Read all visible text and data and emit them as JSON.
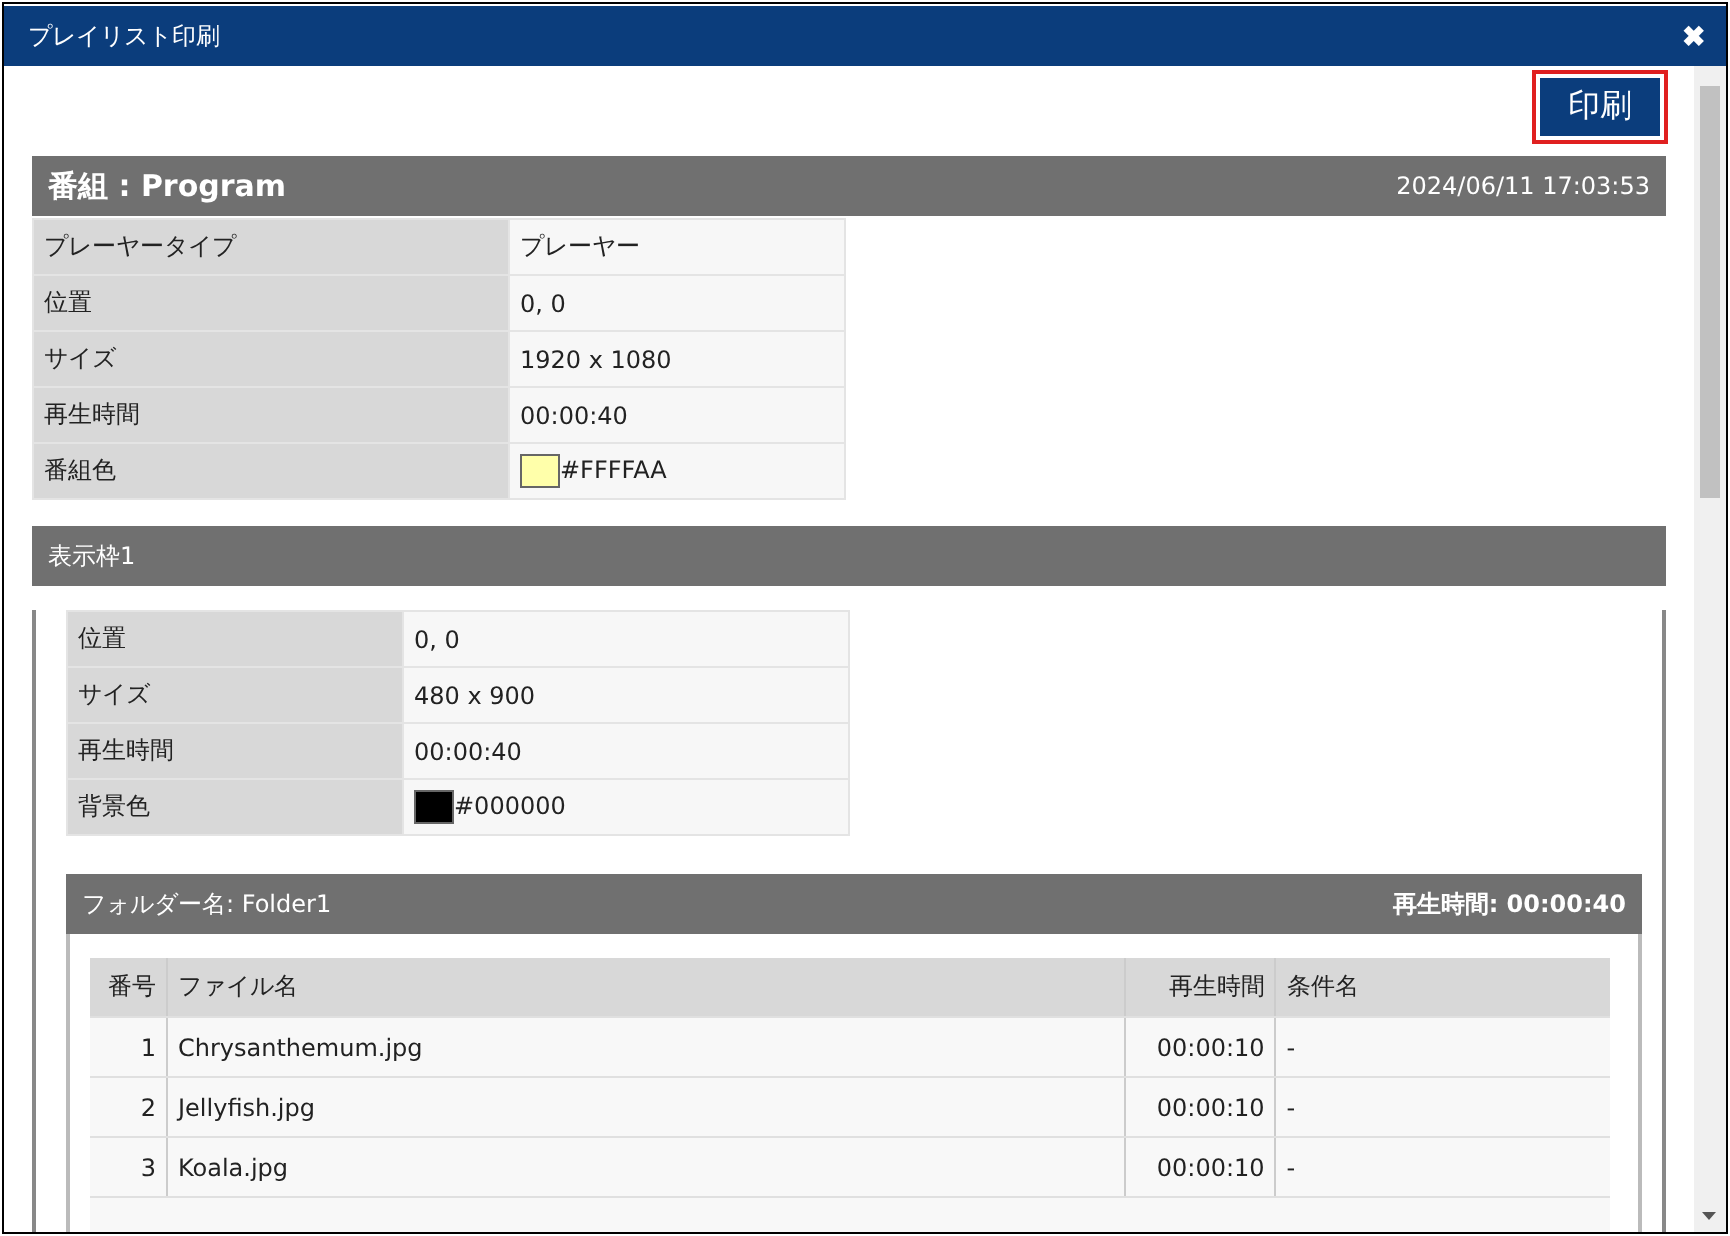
{
  "window": {
    "title": "プレイリスト印刷",
    "close": "✖"
  },
  "print_button": "印刷",
  "program": {
    "title": "番組 : Program",
    "timestamp": "2024/06/11 17:03:53",
    "properties": [
      {
        "label": "プレーヤータイプ",
        "value": "プレーヤー"
      },
      {
        "label": "位置",
        "value": "0, 0"
      },
      {
        "label": "サイズ",
        "value": "1920 x 1080"
      },
      {
        "label": "再生時間",
        "value": "00:00:40"
      },
      {
        "label": "番組色",
        "value": "#FFFFAA",
        "color": "#ffffaa"
      }
    ]
  },
  "frame": {
    "title": "表示枠1",
    "properties": [
      {
        "label": "位置",
        "value": "0, 0"
      },
      {
        "label": "サイズ",
        "value": "480 x 900"
      },
      {
        "label": "再生時間",
        "value": "00:00:40"
      },
      {
        "label": "背景色",
        "value": "#000000",
        "color": "#000000"
      }
    ],
    "folder": {
      "title": "フォルダー名: Folder1",
      "duration": "再生時間: 00:00:40",
      "table": {
        "columns": [
          "番号",
          "ファイル名",
          "再生時間",
          "条件名"
        ],
        "rows": [
          [
            "1",
            "Chrysanthemum.jpg",
            "00:00:10",
            "-"
          ],
          [
            "2",
            "Jellyfish.jpg",
            "00:00:10",
            "-"
          ],
          [
            "3",
            "Koala.jpg",
            "00:00:10",
            "-"
          ]
        ]
      }
    }
  }
}
